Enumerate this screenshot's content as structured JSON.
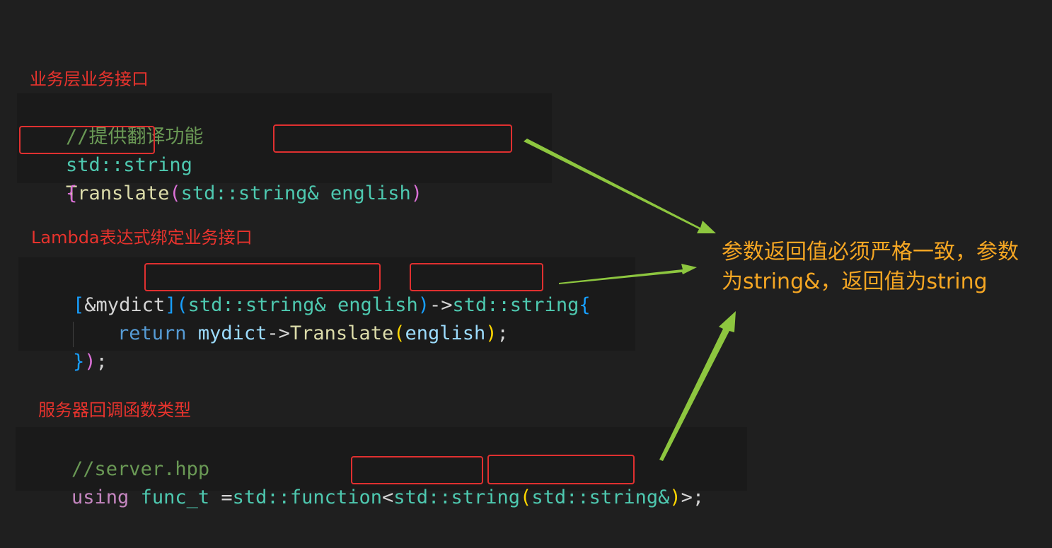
{
  "labels": {
    "business_interface": "业务层业务接口",
    "lambda_binding": "Lambda表达式绑定业务接口",
    "callback_type": "服务器回调函数类型"
  },
  "panel1": {
    "comment": "//提供翻译功能",
    "ret_type": "std::string",
    "func_name": "Translate",
    "lparen": "(",
    "param": "std::string& english",
    "rparen": ")",
    "brace": "{"
  },
  "panel2": {
    "capture": "[&mydict]",
    "lparen": "(",
    "param": "std::string& english",
    "rparen": ")",
    "arrow": "->",
    "ret_type": "std::string",
    "lbrace": "{",
    "return_kw": "return",
    "obj": "mydict",
    "deref": "->",
    "method": "Translate",
    "call_lparen": "(",
    "arg": "english",
    "call_rparen": ")",
    "semicolon": ";",
    "close_brace": "}",
    "close_paren": ")",
    "close_semicolon": ";"
  },
  "panel3": {
    "comment": "//server.hpp",
    "using_kw": "using",
    "alias": "func_t",
    "eq": " =",
    "std_function": "std::function",
    "lt": "<",
    "ret_type": "std::string",
    "lparen": "(",
    "param": "std::string&",
    "rparen": ")",
    "tail": ">;"
  },
  "note": {
    "line1": "参数返回值必须严格一致，参数",
    "line2": "为string&，返回值为string"
  },
  "colors": {
    "label_red": "#e8332d",
    "box_red": "#e03030",
    "arrow_green": "#8dc63f",
    "note_orange": "#f5a623"
  }
}
